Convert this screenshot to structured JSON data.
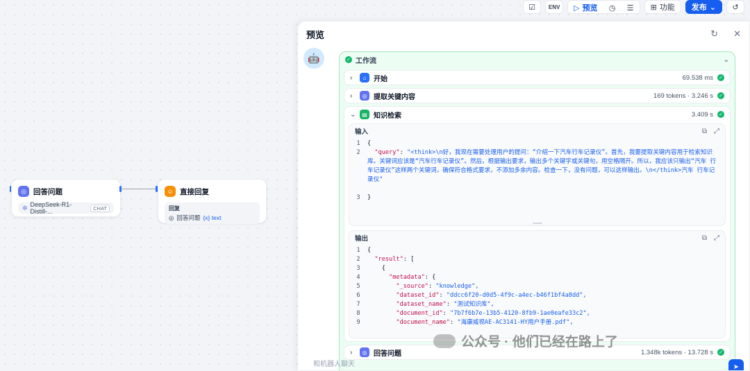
{
  "toolbar": {
    "preview_label": "预览",
    "features_label": "功能",
    "publish_label": "发布"
  },
  "nodes": {
    "answer": {
      "title": "回答问题",
      "model": "DeepSeek-R1-Distill-...",
      "mode": "CHAT"
    },
    "reply": {
      "title": "直接回复",
      "section_label": "回复",
      "var_node": "回答问题",
      "var_name": "{x} text"
    }
  },
  "panel": {
    "title": "预览",
    "workflow_label": "工作流",
    "steps": [
      {
        "name": "开始",
        "meta": "69.538 ms"
      },
      {
        "name": "提取关键内容",
        "meta": "169 tokens · 3.246 s"
      },
      {
        "name": "知识检索",
        "meta": "3.409 s"
      }
    ],
    "input_label": "输入",
    "input_lines": [
      "1",
      "2",
      "3"
    ],
    "input_query_key": "\"query\"",
    "input_query_value": "\"<think>\\n好，我现在需要处理用户的提问：“介绍一下汽车行车记录仪”。首先，我要提取关键内容用于检索知识库。关键词应该是“汽车行车记录仪”。然后，根据输出要求，输出多个关键字或关键句，用空格隔开。所以，我应该只输出“汽车 行车记录仪”这样两个关键词，确保符合格式要求，不添加多余内容。检查一下，没有问题，可以这样输出。\\n</think>汽车 行车记录仪\"",
    "output_label": "输出",
    "output_lines": [
      {
        "n": "1",
        "key": "",
        "val": "{"
      },
      {
        "n": "2",
        "key": "\"result\"",
        "val": "["
      },
      {
        "n": "3",
        "key": "",
        "val": "{"
      },
      {
        "n": "4",
        "key": "\"metadata\"",
        "val": "{"
      },
      {
        "n": "5",
        "key": "\"_source\"",
        "val": "\"knowledge\","
      },
      {
        "n": "6",
        "key": "\"dataset_id\"",
        "val": "\"ddcc6f20-d0d5-4f9c-a4ec-b46f1bf4a8dd\","
      },
      {
        "n": "7",
        "key": "\"dataset_name\"",
        "val": "\"测试知识库\","
      },
      {
        "n": "8",
        "key": "\"document_id\"",
        "val": "\"7b7f6b7e-13b5-4120-8fb9-1ae0eafe33c2\","
      },
      {
        "n": "9",
        "key": "\"document_name\"",
        "val": "\"海康威视AE-AC3141-HY用户手册.pdf\","
      }
    ],
    "last_step": {
      "name": "回答问题",
      "meta": "1.348k tokens · 13.728 s"
    },
    "input_placeholder": "和机器人聊天"
  },
  "watermark": "公众号 · 他们已经在路上了",
  "colors": {
    "accent": "#155eef",
    "success": "#12b76a",
    "workflow_bg": "#ecfdf3"
  }
}
